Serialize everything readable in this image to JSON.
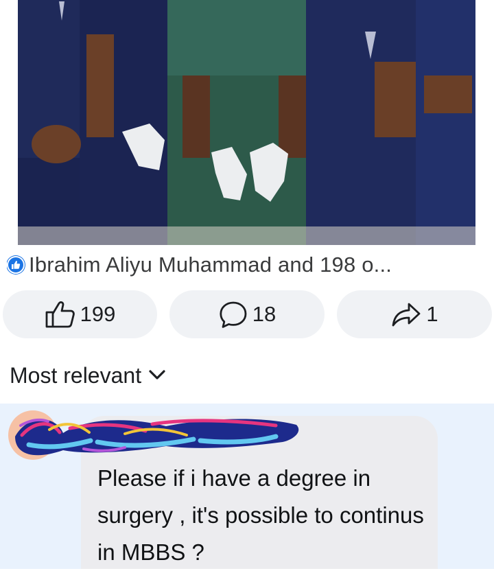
{
  "post": {
    "photo_icon": "group-photo-medical-scrubs",
    "reactors_text": "Ibrahim Aliyu Muhammad and 198 o...",
    "like_badge_icon": "like-badge-icon"
  },
  "actions": {
    "like": {
      "icon": "thumbs-up-icon",
      "count": "199"
    },
    "comment": {
      "icon": "comment-bubble-icon",
      "count": "18"
    },
    "share": {
      "icon": "share-arrow-icon",
      "count": "1"
    }
  },
  "sort": {
    "label": "Most relevant",
    "icon": "chevron-down-icon"
  },
  "comment": {
    "text": "Please if i have a degree in surgery , it's possible to continus in MBBS ?"
  },
  "colors": {
    "accent": "#1b74e4",
    "pill_bg": "#f0f2f5",
    "comment_highlight": "#e9f2fd",
    "bubble_bg": "#ececef"
  }
}
